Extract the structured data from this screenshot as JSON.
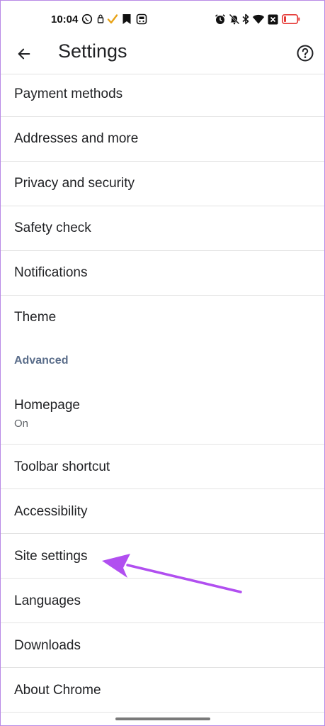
{
  "status_bar": {
    "time": "10:04",
    "left_icons": [
      "whatsapp-icon",
      "notification-icon",
      "check-icon",
      "bookmark-icon",
      "bus-icon"
    ],
    "right_icons": [
      "alarm-icon",
      "mute-icon",
      "bluetooth-icon",
      "wifi-icon",
      "sim-icon",
      "battery-low-icon"
    ],
    "accent_color": "#e8a317",
    "battery_color": "#e53935"
  },
  "app_bar": {
    "title": "Settings"
  },
  "items": [
    {
      "label": "Payment methods"
    },
    {
      "label": "Addresses and more"
    },
    {
      "label": "Privacy and security"
    },
    {
      "label": "Safety check"
    },
    {
      "label": "Notifications"
    },
    {
      "label": "Theme"
    }
  ],
  "section_header": "Advanced",
  "advanced_items": [
    {
      "label": "Homepage",
      "sub": "On"
    },
    {
      "label": "Toolbar shortcut"
    },
    {
      "label": "Accessibility"
    },
    {
      "label": "Site settings"
    },
    {
      "label": "Languages"
    },
    {
      "label": "Downloads"
    },
    {
      "label": "About Chrome"
    }
  ],
  "annotation": {
    "color": "#b14ff0",
    "points_to": "Site settings"
  }
}
